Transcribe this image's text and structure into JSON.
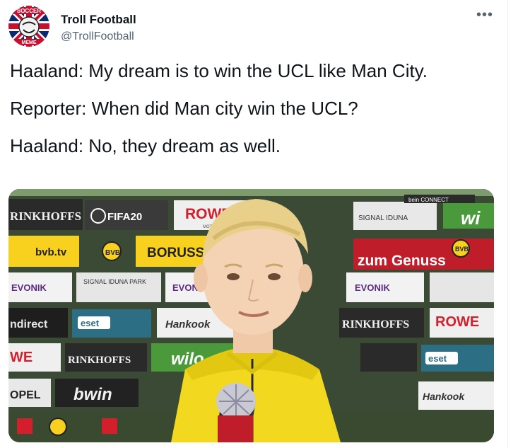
{
  "account": {
    "display_name": "Troll Football",
    "handle": "@TrollFootball",
    "avatar_text_top": "SOCCER",
    "avatar_text_bottom": "MEME"
  },
  "more_icon": "•••",
  "tweet": {
    "lines": [
      "Haaland: My dream is to win the UCL like Man City.",
      "Reporter: When did Man city win the UCL?",
      "Haaland: No, they dream as well."
    ]
  },
  "media": {
    "sponsor_boards": {
      "brinkhoffs": "RINKHOFFS",
      "fifa": "FIFA20",
      "rowe": "ROWE",
      "rowe_sub": "MOTOR OIL",
      "signal_iduna": "SIGNAL IDUNA",
      "bvb_tv": "bvb.tv",
      "borussia": "BORUSSIA",
      "zum_genuss": "zum Genuss",
      "evonik": "EVONIK",
      "signal_park": "SIGNAL IDUNA PARK",
      "eset": "eset",
      "hankook": "Hankook",
      "wilo": "wilo",
      "bwin": "bwin",
      "opel": "OPEL",
      "indirect": "ndirect",
      "bein": "bein CONNECT",
      "we": "WE"
    }
  },
  "colors": {
    "text": "#0f1419",
    "secondary": "#536471",
    "board_yellow": "#f7d11e",
    "jersey_yellow": "#f2d81f"
  }
}
